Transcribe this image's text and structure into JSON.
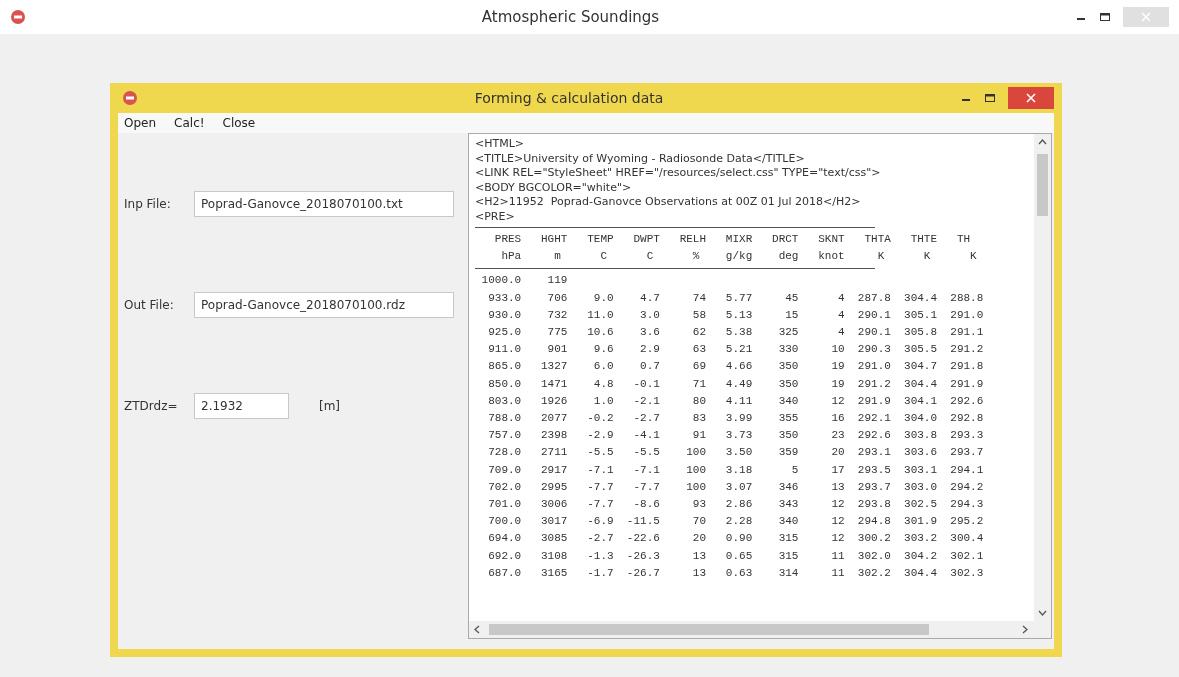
{
  "window": {
    "title": "Atmospheric Soundings"
  },
  "dialog": {
    "title": "Forming & calculation data",
    "menu": [
      "Open",
      "Calc!",
      "Close"
    ],
    "fields": [
      {
        "label": "Inp File:",
        "value": "Poprad-Ganovce_2018070100.txt"
      },
      {
        "label": "Out File:",
        "value": "Poprad-Ganovce_2018070100.rdz"
      },
      {
        "label": "ZTDrdz=",
        "value": "2.1932",
        "unit": "[m]"
      }
    ],
    "text": {
      "head_lines": [
        "<HTML>",
        "<TITLE>University of Wyoming - Radiosonde Data</TITLE>",
        "<LINK REL=\"StyleSheet\" HREF=\"/resources/select.css\" TYPE=\"text/css\">",
        "<BODY BGCOLOR=\"white\">",
        "<H2>11952  Poprad-Ganovce Observations at 00Z 01 Jul 2018</H2>",
        "<PRE>"
      ],
      "column_lines": [
        "   PRES   HGHT   TEMP   DWPT   RELH   MIXR   DRCT   SKNT   THTA   THTE   TH",
        "    hPa     m      C      C      %    g/kg    deg   knot     K      K      K"
      ],
      "data_lines": [
        " 1000.0    119",
        "  933.0    706    9.0    4.7     74   5.77     45      4  287.8  304.4  288.8",
        "  930.0    732   11.0    3.0     58   5.13     15      4  290.1  305.1  291.0",
        "  925.0    775   10.6    3.6     62   5.38    325      4  290.1  305.8  291.1",
        "  911.0    901    9.6    2.9     63   5.21    330     10  290.3  305.5  291.2",
        "  865.0   1327    6.0    0.7     69   4.66    350     19  291.0  304.7  291.8",
        "  850.0   1471    4.8   -0.1     71   4.49    350     19  291.2  304.4  291.9",
        "  803.0   1926    1.0   -2.1     80   4.11    340     12  291.9  304.1  292.6",
        "  788.0   2077   -0.2   -2.7     83   3.99    355     16  292.1  304.0  292.8",
        "  757.0   2398   -2.9   -4.1     91   3.73    350     23  292.6  303.8  293.3",
        "  728.0   2711   -5.5   -5.5    100   3.50    359     20  293.1  303.6  293.7",
        "  709.0   2917   -7.1   -7.1    100   3.18      5     17  293.5  303.1  294.1",
        "  702.0   2995   -7.7   -7.7    100   3.07    346     13  293.7  303.0  294.2",
        "  701.0   3006   -7.7   -8.6     93   2.86    343     12  293.8  302.5  294.3",
        "  700.0   3017   -6.9  -11.5     70   2.28    340     12  294.8  301.9  295.2",
        "  694.0   3085   -2.7  -22.6     20   0.90    315     12  300.2  303.2  300.4",
        "  692.0   3108   -1.3  -26.3     13   0.65    315     11  302.0  304.2  302.1",
        "  687.0   3165   -1.7  -26.7     13   0.63    314     11  302.2  304.4  302.3"
      ]
    }
  }
}
